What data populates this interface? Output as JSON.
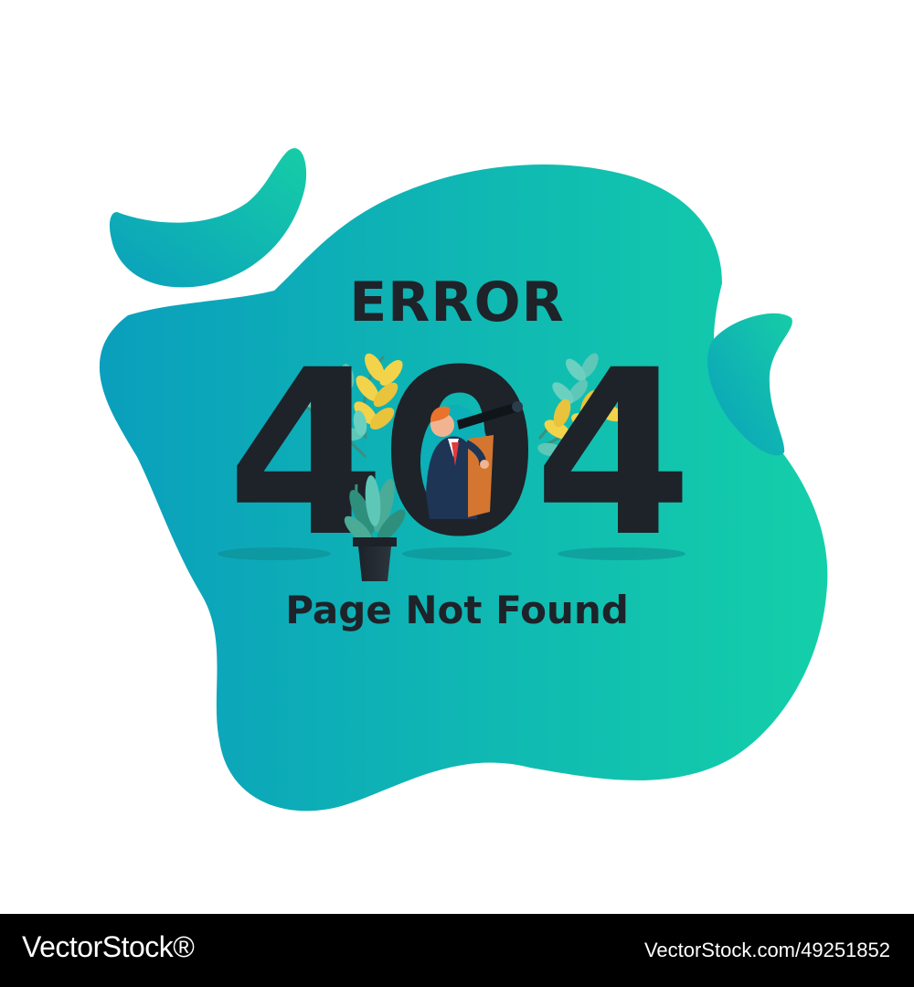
{
  "illustration": {
    "heading": "ERROR",
    "code": "404",
    "subtitle": "Page Not Found",
    "icons": [
      "blob-shape",
      "leaf-branch-icon",
      "potted-plant-icon",
      "businessman-with-telescope-icon"
    ]
  },
  "footer": {
    "brand": "VectorStock®",
    "image_id": "VectorStock.com/49251852"
  },
  "colors": {
    "blob_start": "#0a9fbd",
    "blob_end": "#14cfa9",
    "text_dark": "#1d2329",
    "leaf_yellow": "#f2d34a",
    "leaf_teal": "#5fc7b8",
    "suit": "#1e3556",
    "tie": "#e23b3b",
    "hair": "#e9732c",
    "footer_bg": "#000000",
    "footer_text": "#ffffff"
  }
}
